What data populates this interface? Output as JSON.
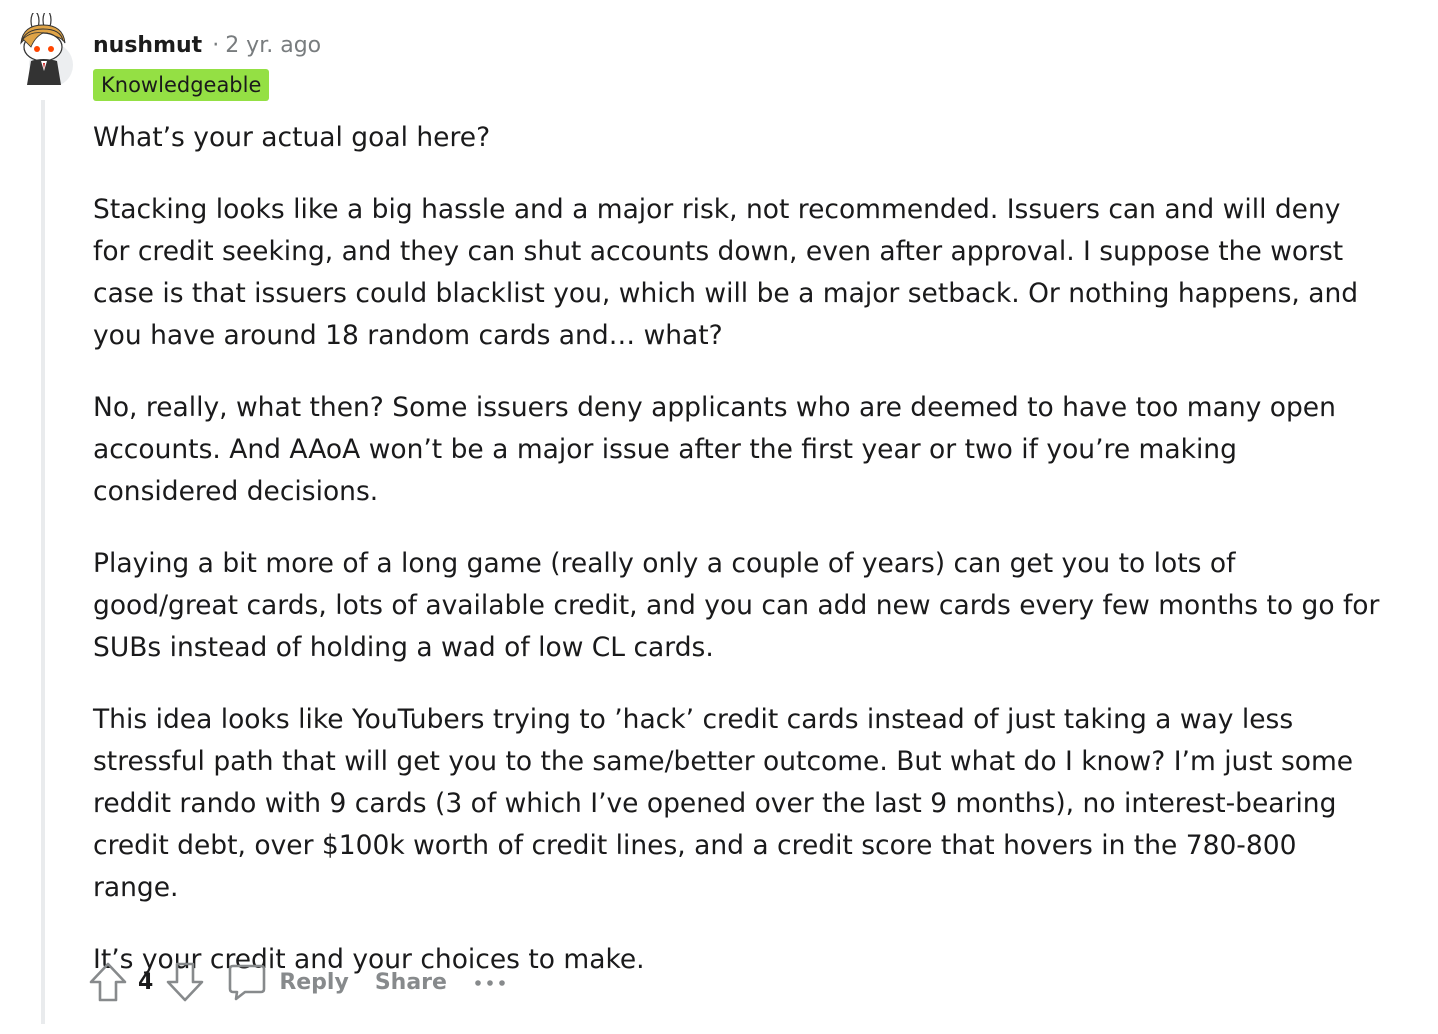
{
  "comment": {
    "author": "nushmut",
    "separator": "·",
    "time": "2 yr. ago",
    "flair": "Knowledgeable",
    "flair_color": "#94e044",
    "paragraphs": [
      "What’s your actual goal here?",
      "Stacking looks like a big hassle and a major risk, not recommended. Issuers can and will deny for credit seeking, and they can shut accounts down, even after approval. I suppose the worst case is that issuers could blacklist you, which will be a major setback. Or nothing happens, and you have around 18 random cards and… what?",
      "No, really, what then? Some issuers deny applicants who are deemed to have too many open accounts. And AAoA won’t be a major issue after the first year or two if you’re making considered decisions.",
      "Playing a bit more of a long game (really only a couple of years) can get you to lots of good/great cards, lots of available credit, and you can add new cards every few months to go for SUBs instead of holding a wad of low CL cards.",
      "This idea looks like YouTubers trying to ’hack’ credit cards instead of just taking a way less stressful path that will get you to the same/better outcome. But what do I know? I’m just some reddit rando with 9 cards (3 of which I’ve opened over the last 9 months), no interest-bearing credit debt, over $100k worth of credit lines, and a credit score that hovers in the 780-800 range.",
      "It’s your credit and your choices to make."
    ]
  },
  "actions": {
    "vote_count": "4",
    "reply_label": "Reply",
    "share_label": "Share",
    "more_label": "···"
  },
  "icons": {
    "avatar": "snoo-avatar",
    "upvote": "upvote-arrow-icon",
    "downvote": "downvote-arrow-icon",
    "reply": "comment-bubble-icon",
    "more": "ellipsis-icon"
  }
}
